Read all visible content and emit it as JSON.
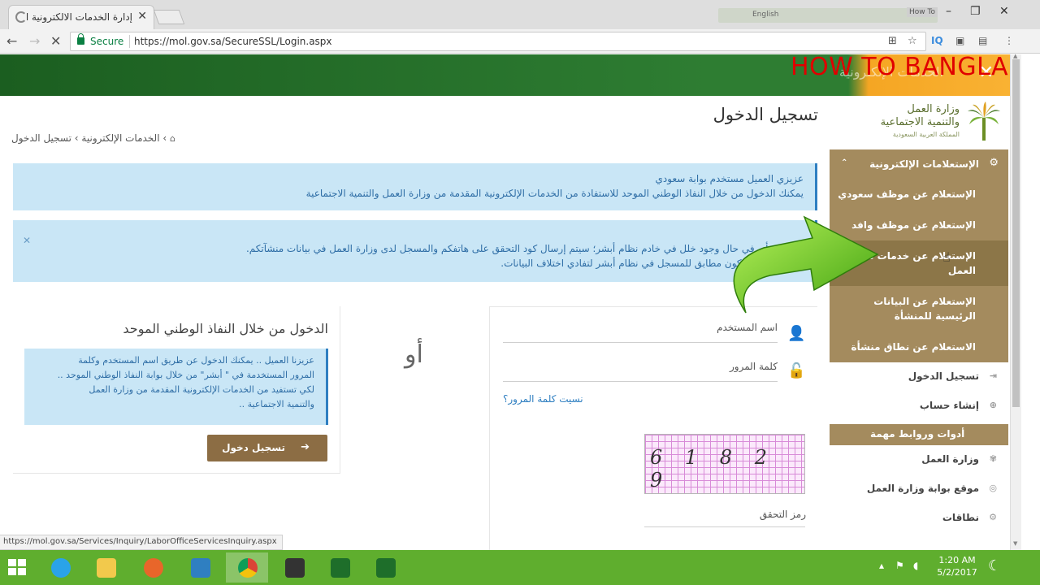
{
  "browser": {
    "tab_title": "إدارة الخدمات الالكترونية ا",
    "secure_label": "Secure",
    "url": "https://mol.gov.sa/SecureSSL/Login.aspx",
    "overlay_language": "English",
    "overlay_howto": "How To",
    "status_url": "https://mol.gov.sa/Services/Inquiry/LaborOfficeServicesInquiry.aspx"
  },
  "watermark": {
    "text": "HOW TO BANGLA",
    "color": "#e00000"
  },
  "banner": {
    "title": "الخدمات الإلكترونية"
  },
  "logo": {
    "line1": "وزارة العمل",
    "line2": "والتنمية الاجتماعية",
    "line3": "المملكة العربية السعودية"
  },
  "page": {
    "title": "تسجيل الدخول",
    "breadcrumb": {
      "home_icon": "home-icon",
      "section": "الخدمات الإلكترونية",
      "separator": "›",
      "current": "تسجيل الدخول"
    }
  },
  "alerts": {
    "welcome_line1": "عزيزي العميل مستخدم بوابة سعودي",
    "welcome_line2": "يمكنك الدخول من خلال النفاذ الوطني الموحد للاستفادة من الخدمات الإلكترونية المقدمة من وزارة العمل والتنمية الاجتماعية",
    "notice_line1": "عنايتكم بأنه في حال وجود خلل في خادم نظام أبشر؛ سيتم إرسال كود التحقق على هاتفكم والمسجل لدى وزارة العمل في بيانات منشآتكم.",
    "notice_line2": "جوال يجب أن يكون مطابق للمسجل في نظام أبشر لتفادي اختلاف البيانات."
  },
  "login": {
    "username_label": "اسم المستخدم",
    "password_label": "كلمة المرور",
    "forgot_password": "نسيت كلمة المرور؟",
    "captcha_text": "6 1 8 2 9",
    "verification_label": "رمز التحقق"
  },
  "or_label": "أو",
  "national": {
    "title": "الدخول من خلال النفاذ الوطني الموحد",
    "info_line1": "عزيزنا العميل .. يمكنك الدخول عن طريق اسم المستخدم وكلمة",
    "info_line2": "المرور المستخدمة في \" أبشر\" من خلال بوابة النفاذ الوطني الموحد ..",
    "info_line3": "لكي تستفيد من الخدمات الإلكترونية المقدمة من وزارة العمل",
    "info_line4": "والتنمية الاجتماعية ..",
    "button_label": "تسجيل دخول"
  },
  "sidebar": {
    "section_title": "الإستعلامات الإلكترونية",
    "items": [
      {
        "label": "الإستعلام عن موظف سعودي"
      },
      {
        "label": "الإستعلام عن موظف وافد"
      },
      {
        "label": "الإستعلام عن خدمات مكتب العمل"
      },
      {
        "label": "الإستعلام عن البيانات الرئيسية للمنشأة"
      },
      {
        "label": "الاستعلام عن نطاق منشأة"
      }
    ],
    "links": [
      {
        "label": "تسجيل الدخول"
      },
      {
        "label": "إنشاء حساب"
      }
    ],
    "tools_title": "أدوات وروابط مهمة",
    "tool_links": [
      {
        "label": "وزارة العمل"
      },
      {
        "label": "موقع بوابة وزارة العمل"
      },
      {
        "label": "نطاقات"
      }
    ]
  },
  "taskbar": {
    "time": "1:20 AM",
    "date": "5/2/2017"
  },
  "colors": {
    "sidebar_bg": "#a48b5e",
    "alert_bg": "#c9e6f6",
    "alert_text": "#2f6ea6",
    "button_bg": "#8c6d44",
    "banner_green": "#2e7d32",
    "taskbar": "#5fae2e"
  }
}
